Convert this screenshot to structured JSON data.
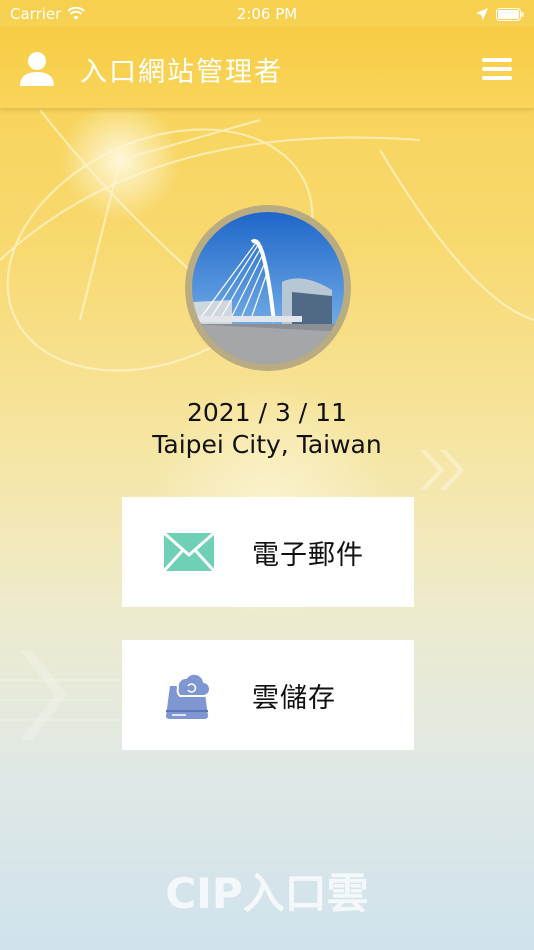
{
  "status_bar": {
    "carrier": "Carrier",
    "time": "2:06 PM"
  },
  "nav": {
    "title": "入口網站管理者"
  },
  "profile": {
    "date": "2021 / 3 / 11",
    "location": "Taipei City, Taiwan"
  },
  "tiles": [
    {
      "label": "電子郵件",
      "icon": "mail-icon",
      "icon_color": "#6fd0b8"
    },
    {
      "label": "雲儲存",
      "icon": "cloud-storage-icon",
      "icon_color": "#7e97d3"
    }
  ],
  "footer": {
    "logo_text": "CIP入口雲"
  },
  "colors": {
    "navbar": "#f7cc43",
    "photo_ring": "#b9ab82"
  }
}
